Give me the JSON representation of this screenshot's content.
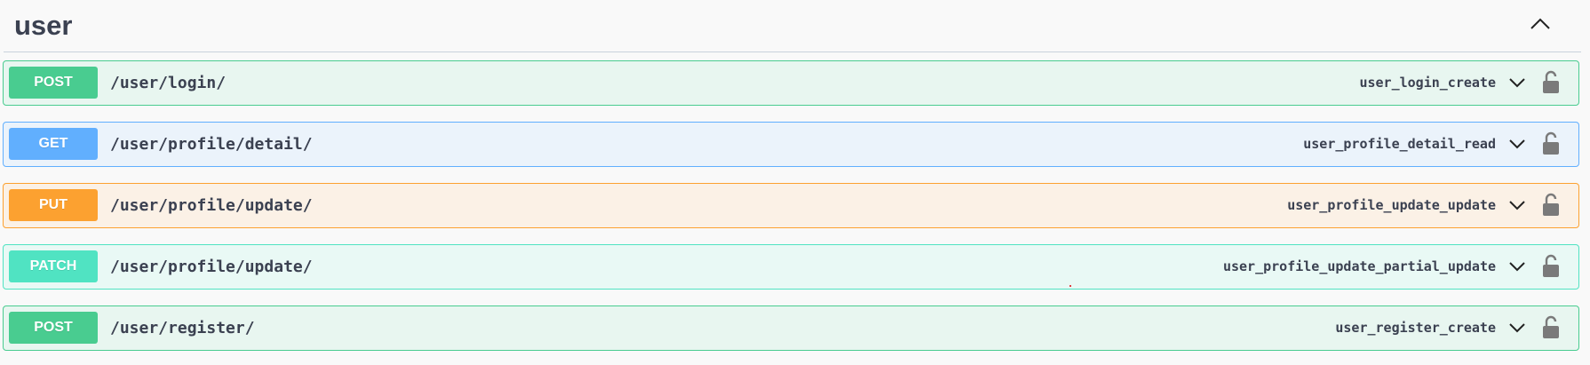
{
  "section": {
    "title": "user",
    "collapse_icon": "chevron-up-icon"
  },
  "operations": [
    {
      "method": "POST",
      "path": "/user/login/",
      "operation_id": "user_login_create",
      "color": "#49cc90"
    },
    {
      "method": "GET",
      "path": "/user/profile/detail/",
      "operation_id": "user_profile_detail_read",
      "color": "#61affe"
    },
    {
      "method": "PUT",
      "path": "/user/profile/update/",
      "operation_id": "user_profile_update_update",
      "color": "#fca130"
    },
    {
      "method": "PATCH",
      "path": "/user/profile/update/",
      "operation_id": "user_profile_update_partial_update",
      "color": "#50e3c2"
    },
    {
      "method": "POST",
      "path": "/user/register/",
      "operation_id": "user_register_create",
      "color": "#49cc90"
    }
  ],
  "icons": {
    "expand": "chevron-down-icon",
    "auth": "unlocked-padlock-icon"
  }
}
